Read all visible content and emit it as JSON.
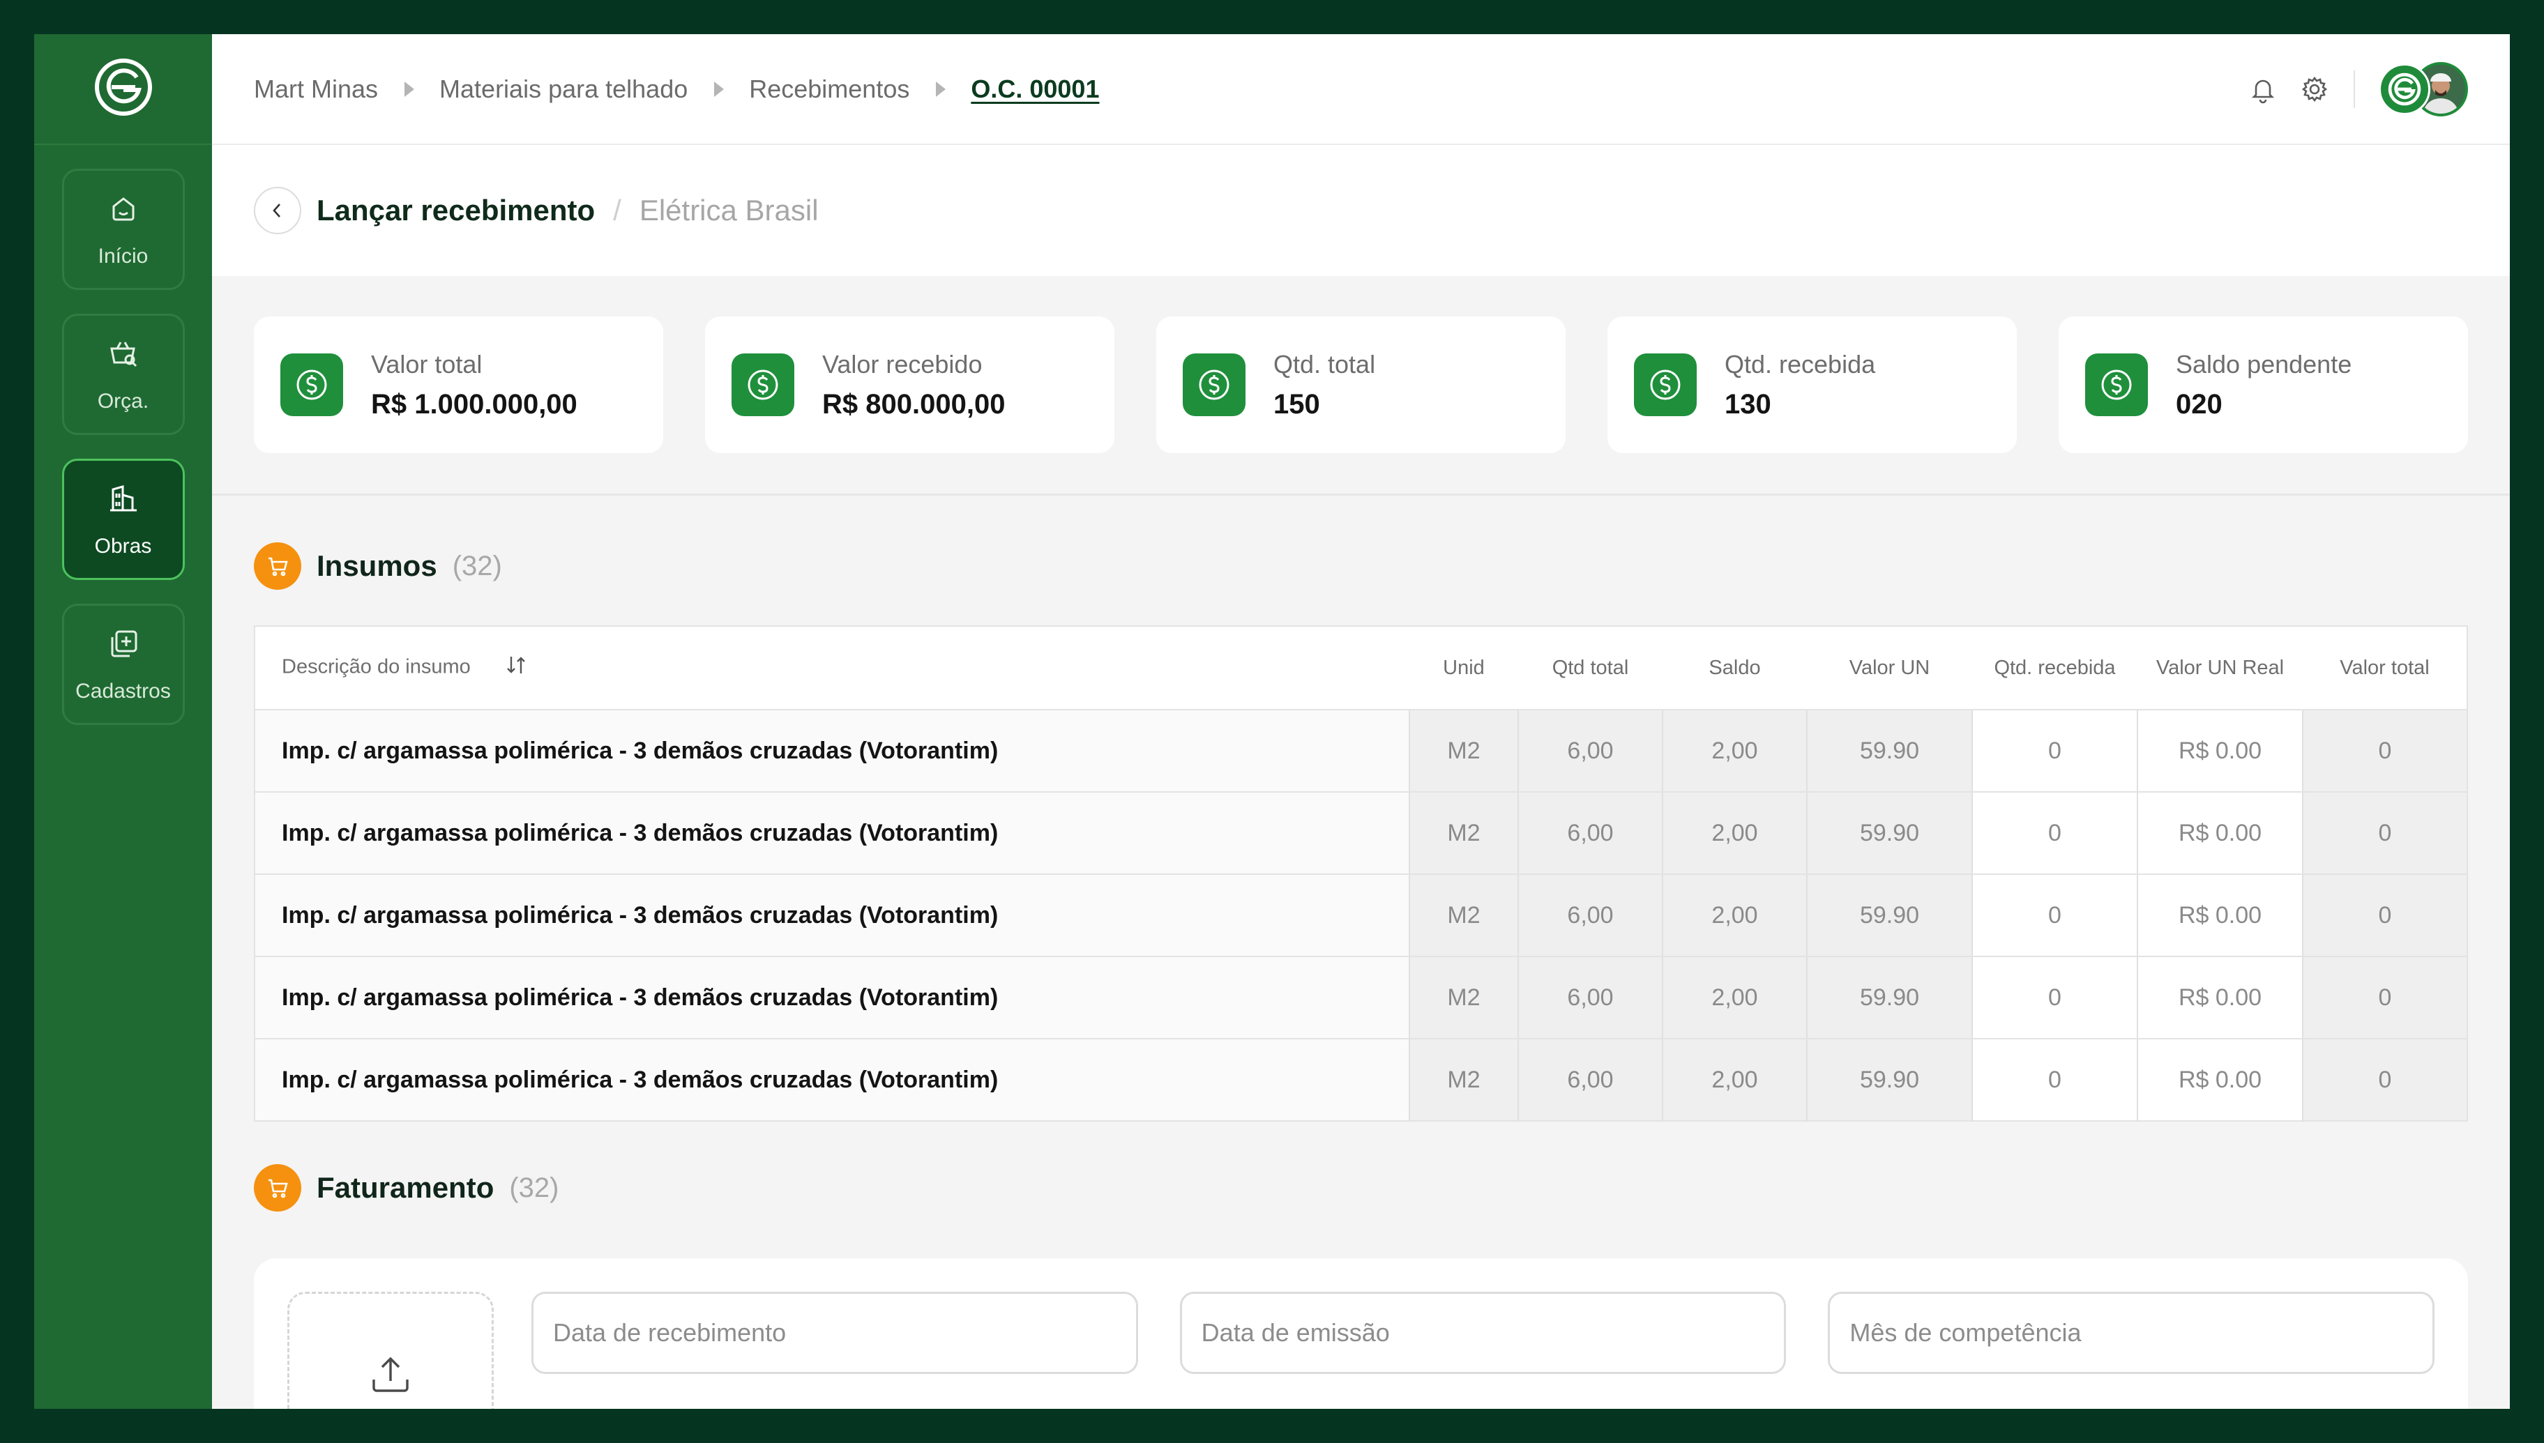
{
  "sidebar": {
    "logo_icon": "brand-logo-icon",
    "items": [
      {
        "label": "Início",
        "icon": "home-icon",
        "active": false
      },
      {
        "label": "Orça.",
        "icon": "basket-search-icon",
        "active": false
      },
      {
        "label": "Obras",
        "icon": "buildings-icon",
        "active": true
      },
      {
        "label": "Cadastros",
        "icon": "add-copy-icon",
        "active": false
      }
    ]
  },
  "breadcrumb": [
    "Mart Minas",
    "Materiais para telhado",
    "Recebimentos",
    "O.C. 00001"
  ],
  "header": {
    "title": "Lançar recebimento",
    "separator": "/",
    "subtitle": "Elétrica Brasil"
  },
  "stats": [
    {
      "label": "Valor total",
      "value": "R$ 1.000.000,00",
      "icon": "dollar-icon"
    },
    {
      "label": "Valor recebido",
      "value": "R$ 800.000,00",
      "icon": "dollar-icon"
    },
    {
      "label": "Qtd. total",
      "value": "150",
      "icon": "dollar-icon"
    },
    {
      "label": "Qtd. recebida",
      "value": "130",
      "icon": "dollar-icon"
    },
    {
      "label": "Saldo pendente",
      "value": "020",
      "icon": "dollar-icon"
    }
  ],
  "insumos": {
    "title": "Insumos",
    "count": "(32)",
    "columns": [
      "Descrição do insumo",
      "Unid",
      "Qtd total",
      "Saldo",
      "Valor UN",
      "Qtd. recebida",
      "Valor UN Real",
      "Valor total"
    ],
    "rows": [
      [
        "Imp. c/ argamassa polimérica - 3 demãos cruzadas (Votorantim)",
        "M2",
        "6,00",
        "2,00",
        "59.90",
        "0",
        "R$ 0.00",
        "0"
      ],
      [
        "Imp. c/ argamassa polimérica - 3 demãos cruzadas (Votorantim)",
        "M2",
        "6,00",
        "2,00",
        "59.90",
        "0",
        "R$ 0.00",
        "0"
      ],
      [
        "Imp. c/ argamassa polimérica - 3 demãos cruzadas (Votorantim)",
        "M2",
        "6,00",
        "2,00",
        "59.90",
        "0",
        "R$ 0.00",
        "0"
      ],
      [
        "Imp. c/ argamassa polimérica - 3 demãos cruzadas (Votorantim)",
        "M2",
        "6,00",
        "2,00",
        "59.90",
        "0",
        "R$ 0.00",
        "0"
      ],
      [
        "Imp. c/ argamassa polimérica - 3 demãos cruzadas (Votorantim)",
        "M2",
        "6,00",
        "2,00",
        "59.90",
        "0",
        "R$ 0.00",
        "0"
      ]
    ]
  },
  "faturamento": {
    "title": "Faturamento",
    "count": "(32)",
    "fields": {
      "data_recebimento": "Data de recebimento",
      "data_emissao": "Data de emissão",
      "mes_competencia": "Mês de competência"
    }
  },
  "colors": {
    "sidebar": "#1f6a32",
    "accent_green": "#1f8f3c",
    "accent_orange": "#f5910f",
    "frame": "#053421"
  }
}
